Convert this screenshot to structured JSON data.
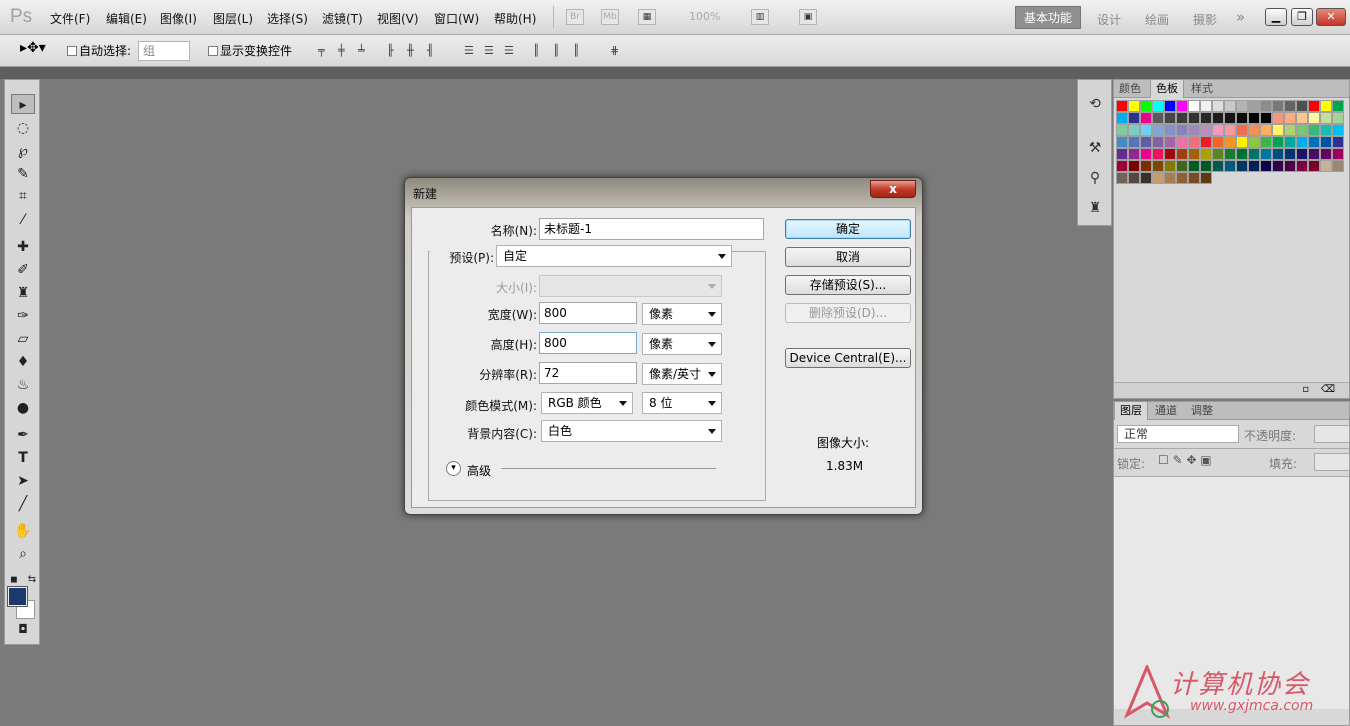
{
  "app": {
    "logo": "Ps",
    "menu": [
      "文件(F)",
      "编辑(E)",
      "图像(I)",
      "图层(L)",
      "选择(S)",
      "滤镜(T)",
      "视图(V)",
      "窗口(W)",
      "帮助(H)"
    ],
    "br_label": "Br",
    "mb_label": "Mb",
    "zoom": "100%",
    "workspaces": [
      "基本功能",
      "设计",
      "绘画",
      "摄影"
    ],
    "more": "»"
  },
  "options": {
    "auto_select_label": "自动选择:",
    "auto_select_value": "组",
    "show_transform_label": "显示变换控件"
  },
  "tools": [
    "移动工具",
    "椭圆选框",
    "套索",
    "快速选择",
    "裁剪",
    "吸管",
    "修复画笔",
    "画笔",
    "仿制图章",
    "历史记录画笔",
    "橡皮擦",
    "油漆桶",
    "模糊",
    "减淡",
    "钢笔",
    "文字",
    "路径选择",
    "直线",
    "抓手",
    "缩放"
  ],
  "colors": {
    "foreground": "#1b3a6b",
    "background": "#ffffff",
    "accent": "#3c7fb1"
  },
  "swatch_panel": {
    "tabs": [
      "颜色",
      "色板",
      "样式"
    ],
    "active_tab": 1,
    "swatches": [
      "#ff0000",
      "#ffff00",
      "#00ff00",
      "#00ffff",
      "#0000ff",
      "#ff00ff",
      "#ffffff",
      "#f0f0f0",
      "#dcdcdc",
      "#c8c8c8",
      "#b4b4b4",
      "#a0a0a0",
      "#8c8c8c",
      "#787878",
      "#646464",
      "#505050",
      "#ff0000",
      "#ffff00",
      "#00a650",
      "#00aeef",
      "#2e3192",
      "#ec008c",
      "#5a5a5a",
      "#464646",
      "#3c3c3c",
      "#323232",
      "#282828",
      "#1e1e1e",
      "#141414",
      "#0a0a0a",
      "#000000",
      "#000000",
      "#f7977a",
      "#f9ad81",
      "#fdc68a",
      "#fff79a",
      "#c4df9b",
      "#a3d39c",
      "#82ca9d",
      "#7bcdc8",
      "#6ecff6",
      "#7ea7d8",
      "#8393ca",
      "#8781bd",
      "#a187be",
      "#bc8dbf",
      "#f49ac2",
      "#f6989d",
      "#f26c4f",
      "#f68e55",
      "#fbaf5c",
      "#fff467",
      "#acd372",
      "#7cc576",
      "#3bb878",
      "#1abbb4",
      "#00bff3",
      "#438ccb",
      "#5574b9",
      "#605ca8",
      "#855fa8",
      "#a763a8",
      "#f06ea9",
      "#f26d7d",
      "#ed1c24",
      "#f26522",
      "#f7941d",
      "#fff200",
      "#8dc63f",
      "#39b54a",
      "#00a651",
      "#00a99d",
      "#00aeef",
      "#0072bc",
      "#0054a6",
      "#2e3192",
      "#662d91",
      "#92278f",
      "#ec008c",
      "#ed145b",
      "#9e0b0f",
      "#a0410d",
      "#a36209",
      "#aba000",
      "#598527",
      "#197b30",
      "#007236",
      "#00746b",
      "#0076a3",
      "#004b80",
      "#003471",
      "#1b1464",
      "#440e62",
      "#630460",
      "#9e005d",
      "#9e0039",
      "#790000",
      "#7b2e00",
      "#7d4900",
      "#827b00",
      "#406618",
      "#005e20",
      "#005826",
      "#005952",
      "#005b7f",
      "#003663",
      "#002157",
      "#0d004c",
      "#32004b",
      "#4b0049",
      "#7b0046",
      "#7a0026",
      "#c7b299",
      "#998675",
      "#736357",
      "#534741",
      "#37302d",
      "#c69c6e",
      "#a67c52",
      "#8c6239",
      "#754c24",
      "#603913"
    ]
  },
  "layers_panel": {
    "tabs": [
      "图层",
      "通道",
      "调整"
    ],
    "active_tab": 0,
    "blend_mode": "正常",
    "opacity_label": "不透明度:",
    "lock_label": "锁定:",
    "fill_label": "填充:"
  },
  "dialog": {
    "title": "新建",
    "close": "x",
    "name_label": "名称(N):",
    "name_value": "未标题-1",
    "preset_label": "预设(P):",
    "preset_value": "自定",
    "size_label": "大小(I):",
    "width_label": "宽度(W):",
    "width_value": "800",
    "width_unit": "像素",
    "height_label": "高度(H):",
    "height_value": "800",
    "height_unit": "像素",
    "resolution_label": "分辨率(R):",
    "resolution_value": "72",
    "resolution_unit": "像素/英寸",
    "colormode_label": "颜色模式(M):",
    "colormode_value": "RGB 颜色",
    "bitdepth_value": "8 位",
    "bg_label": "背景内容(C):",
    "bg_value": "白色",
    "advanced_label": "高级",
    "buttons": {
      "ok": "确定",
      "cancel": "取消",
      "save_preset": "存储预设(S)...",
      "delete_preset": "删除预设(D)...",
      "device_central": "Device Central(E)..."
    },
    "image_size_label": "图像大小:",
    "image_size_value": "1.83M"
  },
  "watermark": {
    "text": "计算机协会",
    "url": "www.gxjmca.com"
  }
}
